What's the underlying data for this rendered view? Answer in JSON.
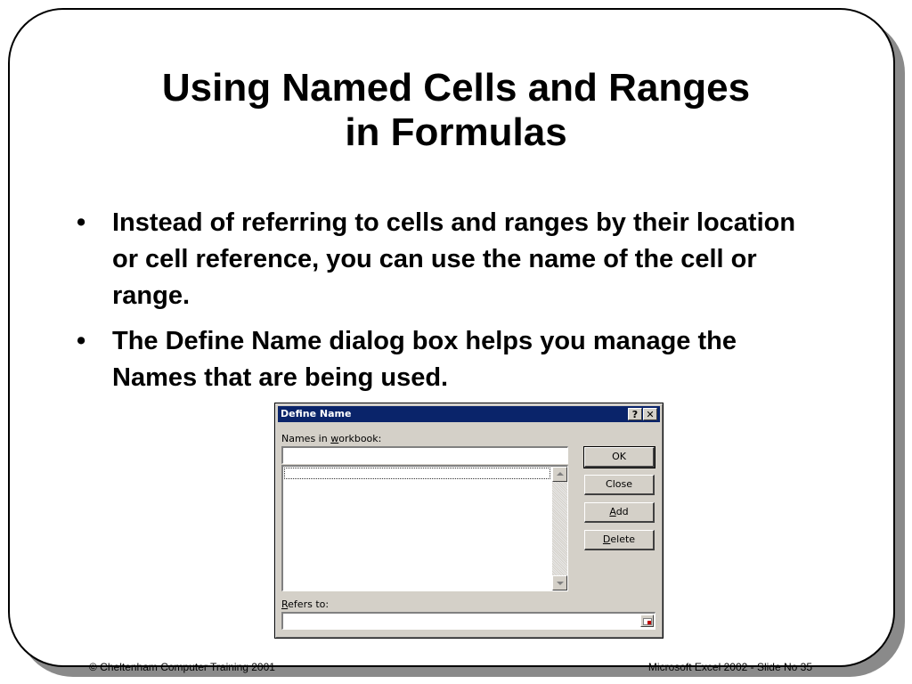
{
  "slide": {
    "title_line1": "Using Named Cells and Ranges",
    "title_line2": "in Formulas",
    "bullets": [
      "Instead of referring to cells and ranges by their location or cell reference, you can use the name of the cell or range.",
      "The Define Name dialog box helps you manage the Names that are being used."
    ],
    "bullet_symbol": "•"
  },
  "dialog": {
    "title": "Define Name",
    "help_symbol": "?",
    "close_symbol": "✕",
    "names_label_pre": "Names in ",
    "names_label_ul": "w",
    "names_label_post": "orkbook:",
    "name_value": "",
    "buttons": {
      "ok": "OK",
      "close": "Close",
      "add_pre": "",
      "add_ul": "A",
      "add_post": "dd",
      "delete_pre": "",
      "delete_ul": "D",
      "delete_post": "elete"
    },
    "refers_label_ul": "R",
    "refers_label_post": "efers to:",
    "refers_value": "",
    "icons": {
      "scroll_up": "arrow-up",
      "scroll_down": "arrow-down",
      "collapse": "collapse-dialog"
    }
  },
  "footer": {
    "left": "© Cheltenham Computer Training 2001",
    "right": "Microsoft Excel 2002 - Slide No 35"
  }
}
